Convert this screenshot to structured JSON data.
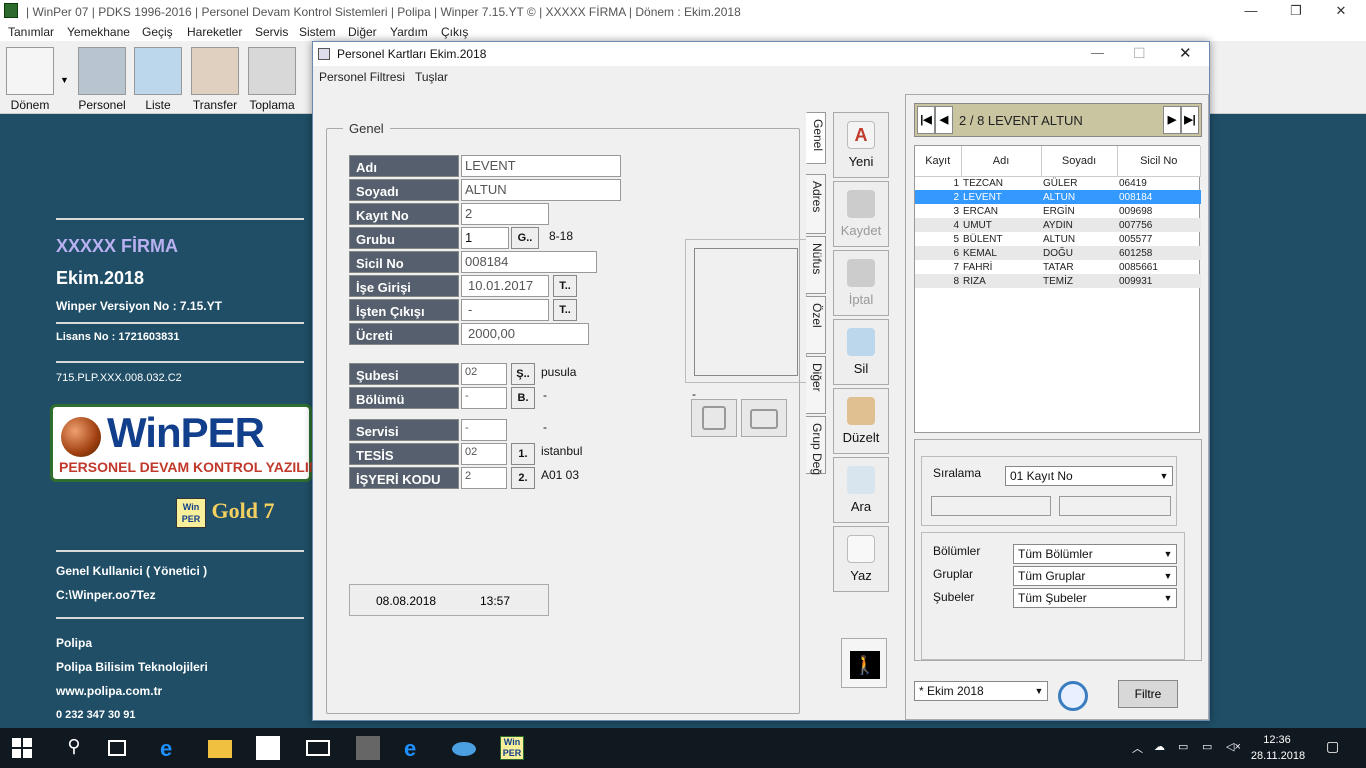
{
  "main_window": {
    "title": "| WinPer 07 | PDKS 1996-2016 | Personel Devam Kontrol Sistemleri | Polipa | Winper 7.15.YT © | XXXXX FİRMA | Dönem : Ekim.2018",
    "minimize": "—",
    "maximize": "❐",
    "close": "✕"
  },
  "menu": [
    "Tanımlar",
    "Yemekhane",
    "Geçiş",
    "Hareketler",
    "Servis",
    "Sistem",
    "Diğer",
    "Yardım",
    "Çıkış"
  ],
  "toolbar": [
    "Dönem",
    "Personel",
    "Liste",
    "Transfer",
    "Toplama"
  ],
  "left_panel": {
    "firm": "XXXXX FİRMA",
    "period": "Ekim.2018",
    "version": "Winper Versiyon No : 7.15.YT",
    "license": "Lisans No : 1721603831",
    "code": "715.PLP.XXX.008.032.C2",
    "logo_word": "WinPER",
    "logo_sub": "PERSONEL DEVAM KONTROL YAZILIMI",
    "gold_icon_top": "Win",
    "gold_icon_bottom": "PER",
    "gold": "Gold 7",
    "user": "Genel Kullanici ( Yönetici )",
    "path": "C:\\Winper.oo7Tez",
    "company": "Polipa",
    "company_full": "Polipa Bilisim Teknolojileri",
    "web": "www.polipa.com.tr",
    "phone": "0 232 347 30 91"
  },
  "dialog": {
    "title": "Personel Kartları Ekim.2018",
    "close": "✕",
    "max": "☐",
    "min": "—",
    "menu": [
      "Personel Filtresi",
      "Tuşlar"
    ],
    "group_title": "Genel",
    "labels": {
      "adi": "Adı",
      "soyadi": "Soyadı",
      "kayitno": "Kayıt No",
      "grubu": "Grubu",
      "sicil": "Sicil No",
      "giris": "İşe Girişi",
      "cikis": "İşten Çıkışı",
      "ucret": "Ücreti",
      "sube": "Şubesi",
      "bolum": "Bölümü",
      "servis": "Servisi",
      "tesis": "TESİS",
      "isyeri": "İŞYERİ KODU"
    },
    "values": {
      "adi": "LEVENT",
      "soyadi": "ALTUN",
      "kayitno": "2",
      "grubu": "1",
      "grubu_desc": "8-18",
      "sicil": "008184",
      "giris": "10.01.2017",
      "cikis": "-",
      "ucret": "2000,00",
      "sube": "02",
      "sube_desc": "pusula",
      "bolum": "-",
      "bolum_desc": "-",
      "servis": "-",
      "servis_desc": "-",
      "tesis": "02",
      "tesis_desc": "istanbul",
      "isyeri": "2",
      "isyeri_desc": "A01 03",
      "photo_caption": "-"
    },
    "small_buttons": {
      "grubu": "G..",
      "giris": "T..",
      "cikis": "T..",
      "sube": "Ş..",
      "bolum": "B.",
      "tesis": "1.",
      "isyeri": "2."
    },
    "date": "08.08.2018",
    "time": "13:57",
    "tabs": [
      "Genel",
      "Adres",
      "Nüfus",
      "Özel",
      "Diğer",
      "Grup Değ"
    ],
    "actions": [
      "Yeni",
      "Kaydet",
      "İptal",
      "Sil",
      "Düzelt",
      "Ara",
      "Yaz"
    ],
    "nav": "2 / 8 LEVENT ALTUN",
    "grid_headers": [
      "Kayıt",
      "Adı",
      "Soyadı",
      "Sicil No"
    ],
    "grid_rows": [
      [
        "1",
        "TEZCAN",
        "GÜLER",
        "06419"
      ],
      [
        "2",
        "LEVENT",
        "ALTUN",
        "008184"
      ],
      [
        "3",
        "ERCAN",
        "ERGİN",
        "009698"
      ],
      [
        "4",
        "UMUT",
        "AYDIN",
        "007756"
      ],
      [
        "5",
        "BÜLENT",
        "ALTUN",
        "005577"
      ],
      [
        "6",
        "KEMAL",
        "DOĞU",
        "601258"
      ],
      [
        "7",
        "FAHRİ",
        "TATAR",
        "0085661"
      ],
      [
        "8",
        "RIZA",
        "TEMİZ",
        "009931"
      ]
    ],
    "sort_label": "Sıralama",
    "sort_value": "01   Kayıt No",
    "filters": [
      {
        "label": "Bölümler",
        "value": "Tüm Bölümler"
      },
      {
        "label": "Gruplar",
        "value": "Tüm Gruplar"
      },
      {
        "label": "Şubeler",
        "value": "Tüm Şubeler"
      }
    ],
    "period_select": "* Ekim 2018",
    "filter_button": "Filtre"
  },
  "taskbar": {
    "time": "12:36",
    "date": "28.11.2018",
    "winper_top": "Win",
    "winper_bottom": "PER"
  }
}
